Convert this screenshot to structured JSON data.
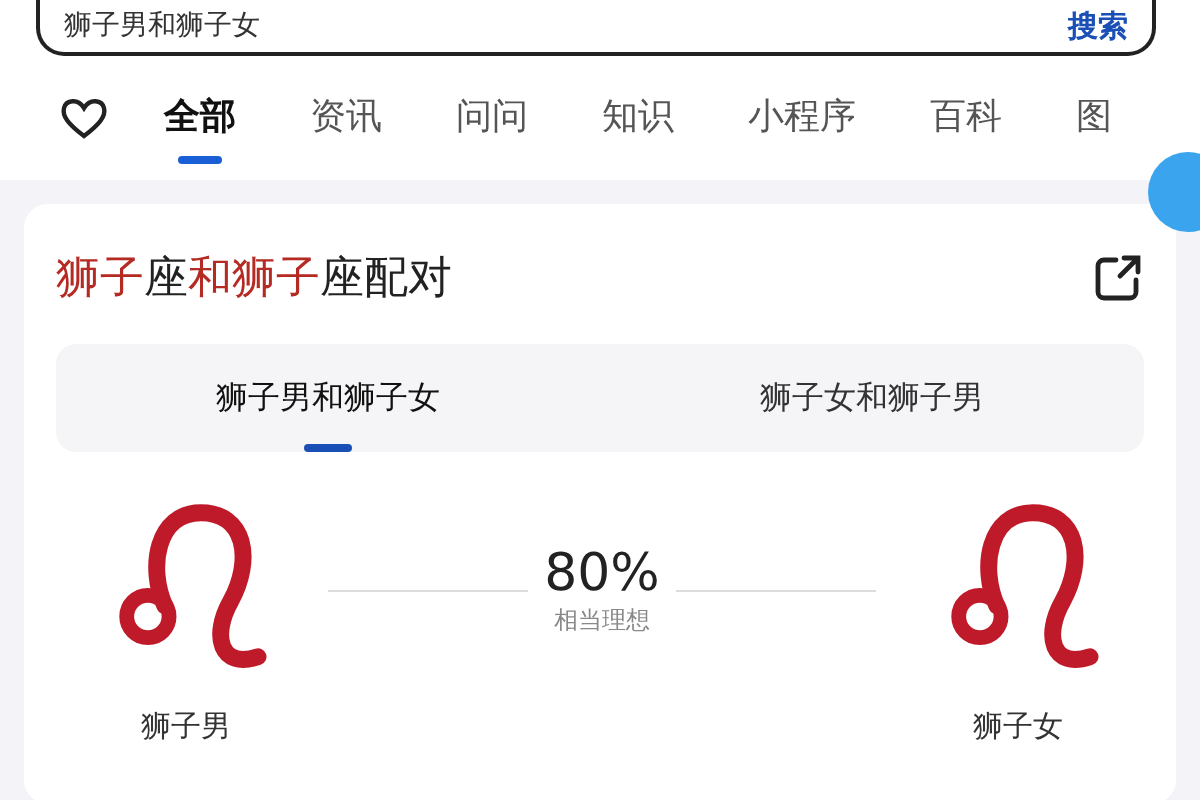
{
  "search": {
    "value": "狮子男和狮子女",
    "button": "搜索"
  },
  "tabs": [
    {
      "label": "全部",
      "selected": true
    },
    {
      "label": "资讯",
      "selected": false
    },
    {
      "label": "问问",
      "selected": false
    },
    {
      "label": "知识",
      "selected": false
    },
    {
      "label": "小程序",
      "selected": false
    },
    {
      "label": "百科",
      "selected": false
    },
    {
      "label": "图",
      "selected": false
    }
  ],
  "card": {
    "title_parts": [
      {
        "text": "狮子",
        "highlight": true
      },
      {
        "text": "座",
        "highlight": false
      },
      {
        "text": "和狮子",
        "highlight": true
      },
      {
        "text": "座配对",
        "highlight": false
      }
    ],
    "segments": [
      {
        "label": "狮子男和狮子女",
        "selected": true
      },
      {
        "label": "狮子女和狮子男",
        "selected": false
      }
    ],
    "left": {
      "name": "狮子男"
    },
    "right": {
      "name": "狮子女"
    },
    "score": "80%",
    "verdict": "相当理想"
  }
}
